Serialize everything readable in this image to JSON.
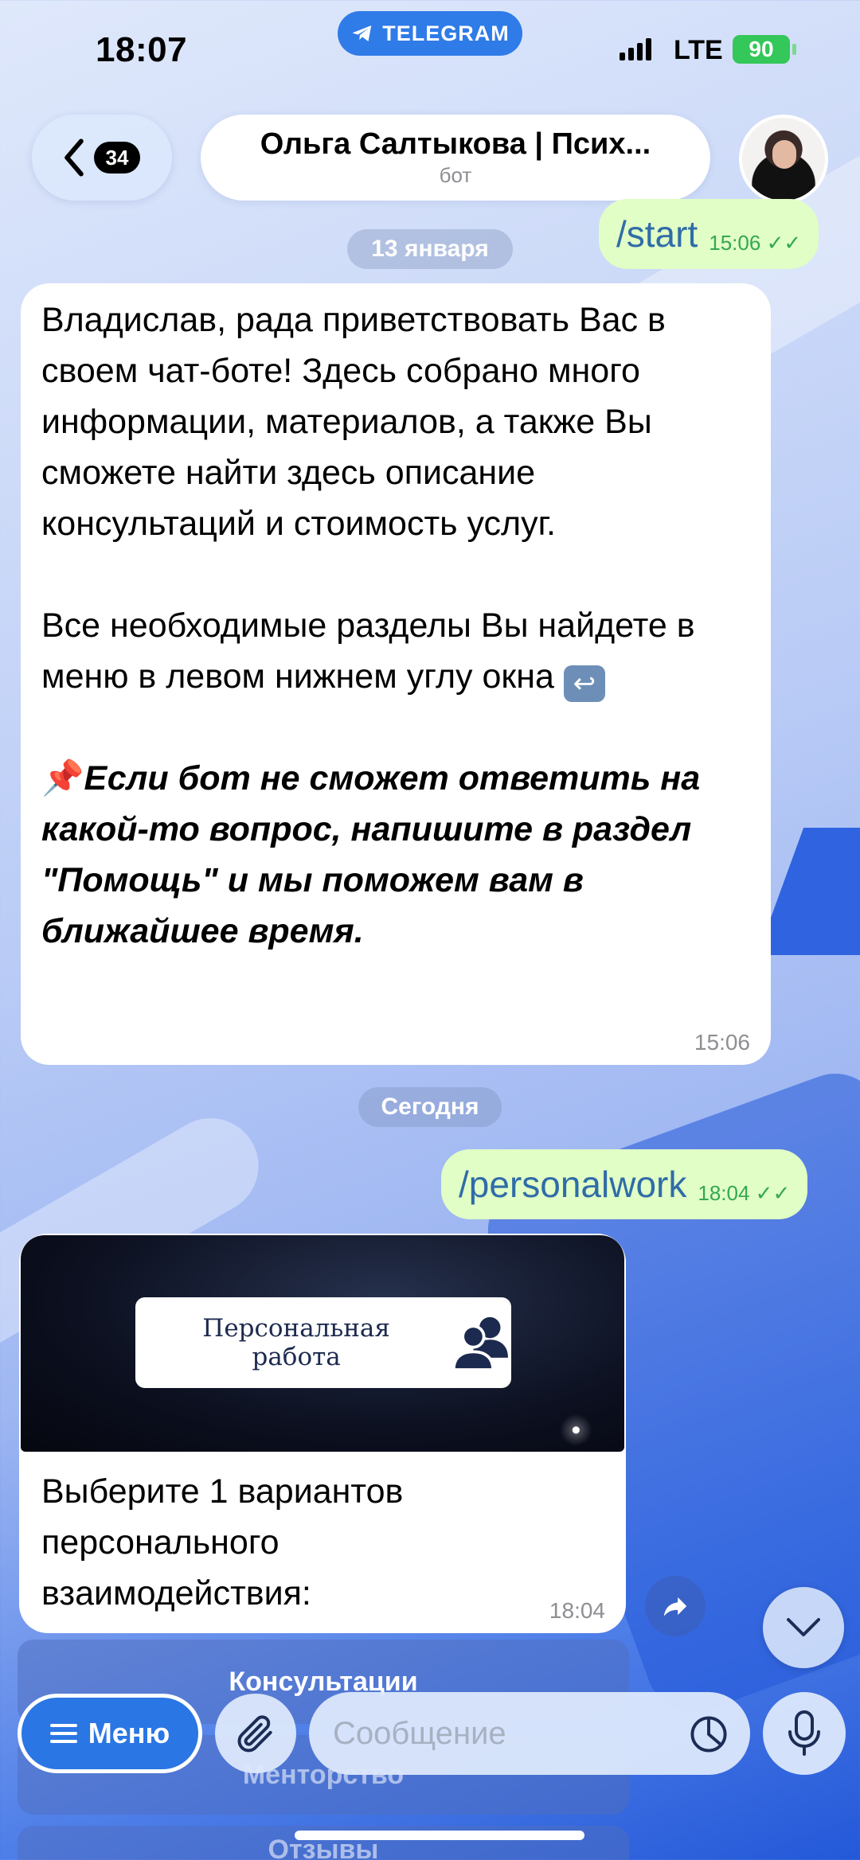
{
  "status_bar": {
    "time": "18:07",
    "app_pill": "TELEGRAM",
    "network": "LTE",
    "battery": "90"
  },
  "header": {
    "unread_count": "34",
    "chat_name": "Ольга Салтыкова | Псих...",
    "chat_subtitle": "бот"
  },
  "messages": {
    "out1": {
      "text": "/start",
      "time": "15:06"
    },
    "date1": "13 января",
    "in1": {
      "p1": "Владислав, рада приветствовать Вас в своем чат-боте! Здесь собрано много информации, материалов, а также Вы сможете найти здесь описание консультаций и стоимость услуг.",
      "p2": "Все необходимые разделы Вы найдете в меню в левом нижнем углу окна",
      "p2_emoji": "↩",
      "p3_emoji": "📌",
      "p3": "Если бот не сможет ответить на какой-то вопрос, напишите в раздел \"Помощь\" и мы поможем вам в ближайшее время.",
      "time": "15:06"
    },
    "date2": "Сегодня",
    "out2": {
      "text": "/personalwork",
      "time": "18:04"
    },
    "in2": {
      "media_title": "Персональная работа",
      "text": "Выберите 1 вариантов персонального взаимодействия:",
      "time": "18:04"
    }
  },
  "keyboard": {
    "buttons": [
      "Консультации",
      "Менторство",
      "Отзывы"
    ]
  },
  "composer": {
    "menu_label": "Меню",
    "placeholder": "Сообщение"
  },
  "colors": {
    "outgoing_bubble": "#e1fec6",
    "link_blue": "#2f6ca8",
    "check_green": "#34a853",
    "accent": "#2a76e4"
  }
}
